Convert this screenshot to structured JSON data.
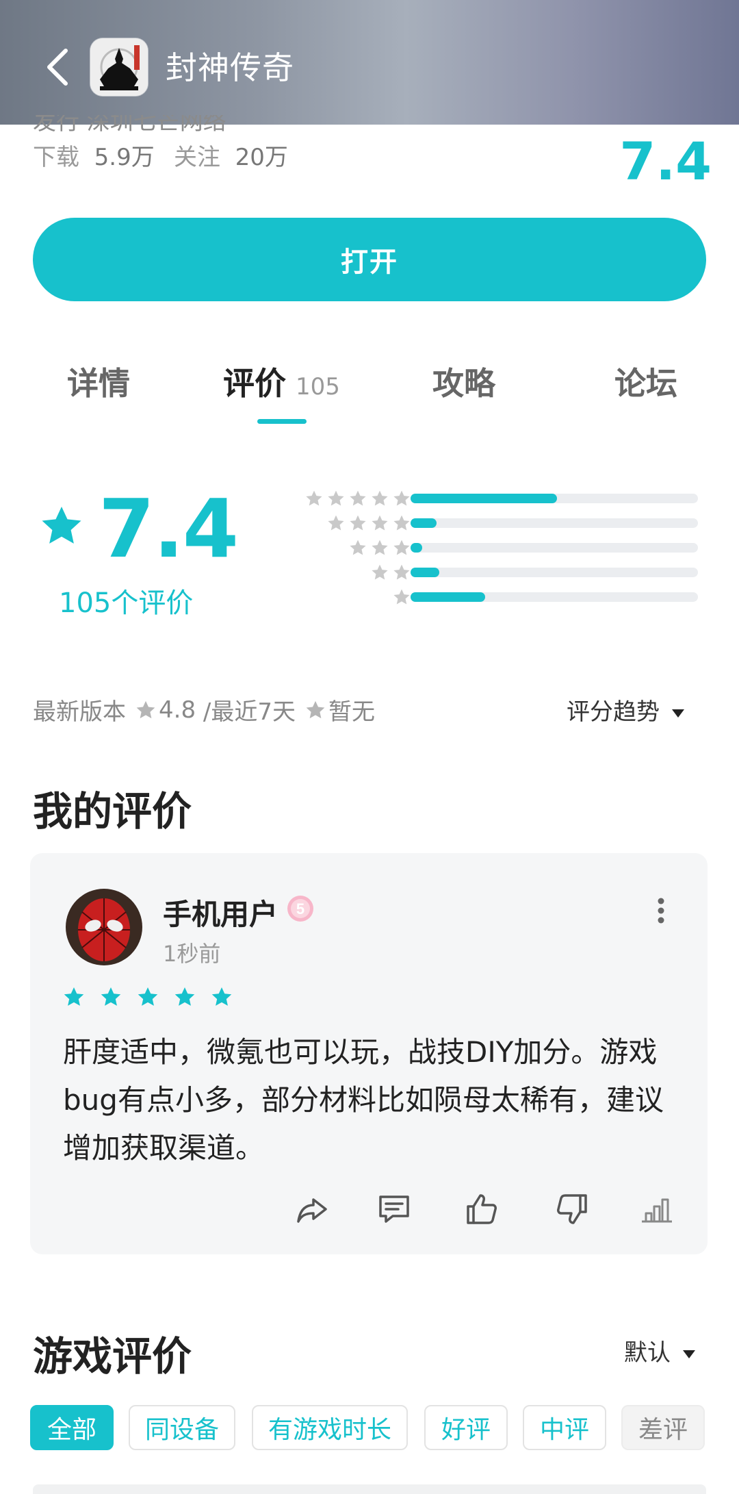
{
  "header": {
    "title": "封神传奇"
  },
  "info": {
    "cut_text": "发行 深圳七芒网络",
    "download_label": "下载",
    "download_value": "5.9万",
    "follow_label": "关注",
    "follow_value": "20万",
    "score": "7.4",
    "open_label": "打开"
  },
  "tabs": [
    {
      "label": "详情"
    },
    {
      "label": "评价",
      "count": "105"
    },
    {
      "label": "攻略"
    },
    {
      "label": "论坛"
    }
  ],
  "rating": {
    "score": "7.4",
    "count_text": "105个评价",
    "distribution": [
      {
        "stars": 5,
        "fraction": 0.51
      },
      {
        "stars": 4,
        "fraction": 0.09
      },
      {
        "stars": 3,
        "fraction": 0.04
      },
      {
        "stars": 2,
        "fraction": 0.1
      },
      {
        "stars": 1,
        "fraction": 0.26
      }
    ],
    "latest_version_label": "最新版本",
    "latest_version_score": "4.8",
    "recent_label": "/最近7天",
    "recent_value": "暂无",
    "trend_label": "评分趋势"
  },
  "my_review": {
    "section_title": "我的评价",
    "username": "手机用户",
    "level": "5",
    "time": "1秒前",
    "stars": 5,
    "text": "肝度适中，微氪也可以玩，战技DIY加分。游戏bug有点小多，部分材料比如陨母太稀有，建议增加获取渠道。"
  },
  "game_reviews": {
    "section_title": "游戏评价",
    "sort_label": "默认",
    "filters": [
      "全部",
      "同设备",
      "有游戏时长",
      "好评",
      "中评",
      "差评"
    ]
  },
  "colors": {
    "accent": "#17c1cc"
  }
}
